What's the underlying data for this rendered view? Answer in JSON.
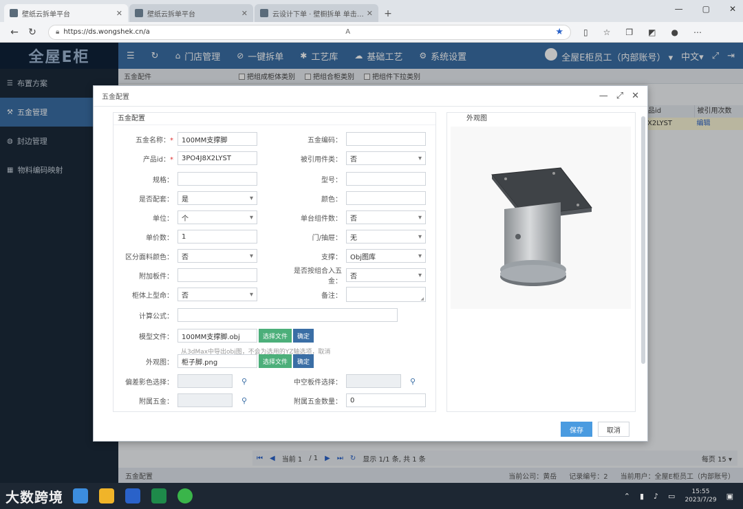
{
  "browser": {
    "tabs": [
      {
        "title": "壁纸云拆单平台",
        "active": true
      },
      {
        "title": "壁纸云拆单平台",
        "active": false
      },
      {
        "title": "云设计下单 · 壁橱拆单 单击…",
        "active": false
      }
    ],
    "url": "https://ds.wongshek.cn/a"
  },
  "app": {
    "logo": "全屋E柜",
    "nav": [
      {
        "icon": "home-icon",
        "label": "门店管理"
      },
      {
        "icon": "split-icon",
        "label": "一键拆单"
      },
      {
        "icon": "tool-icon",
        "label": "工艺库"
      },
      {
        "icon": "process-icon",
        "label": "基础工艺"
      },
      {
        "icon": "gear-icon",
        "label": "系统设置"
      }
    ],
    "user": "全屋E柜员工（内部账号）",
    "lang": "中文"
  },
  "sidebar": {
    "items": [
      {
        "label": "布置方案",
        "active": false
      },
      {
        "label": "五金管理",
        "active": true
      },
      {
        "label": "封边管理",
        "active": false
      },
      {
        "label": "物料编码映射",
        "active": false
      }
    ]
  },
  "main": {
    "crumb": "五金配件",
    "subtabs": [
      "把组成柜体类别",
      "把组合柜类别",
      "把组件下拉类别"
    ],
    "table_headers": [
      "品id",
      "被引用次数"
    ],
    "table_row": {
      "id": "X2LYST",
      "action": "编辑"
    },
    "pager": {
      "page_label": "当前 1",
      "total": "/ 1",
      "summary": "显示 1/1 条, 共 1 条",
      "page_size_label": "每页",
      "page_size": "15"
    },
    "status": {
      "left": "五金配置",
      "company": "当前公司：黄岳",
      "records": "记录编号：2",
      "user": "当前用户：全屋E柜员工（内部账号）"
    }
  },
  "dialog": {
    "title": "五金配置",
    "section_left": "五金配置",
    "section_right": "外观图",
    "fields": {
      "hardware_name_label": "五金名称：",
      "hardware_name": "100MM支撑脚",
      "hardware_code_label": "五金编码：",
      "hardware_code": "",
      "product_id_label": "产品id：",
      "product_id": "3PO4J8X2LYST",
      "order_type_label": "被引用件类：",
      "order_type": "否",
      "spec_label": "规格：",
      "spec": "",
      "model_label": "型号：",
      "model": "",
      "is_package_label": "是否配套：",
      "is_package": "是",
      "color_label": "颜色：",
      "color": "",
      "unit_label": "单位：",
      "unit": "个",
      "unit_qty_label": "单台组件数：",
      "unit_qty": "否",
      "single_qty_label": "单价数：",
      "single_qty": "1",
      "door_direction_label": "门/抽屉：",
      "door_direction": "无",
      "distinguish_label": "区分面料颜色：",
      "distinguish": "否",
      "support_label": "支撑：",
      "support": "Obj图库",
      "attach_label": "附加板件：",
      "attach": "",
      "as_hardware_label": "是否按组合入五金：",
      "as_hardware": "否",
      "upload_label": "柜体上型命：",
      "upload": "否",
      "remark_label": "备注：",
      "remark": "",
      "formula_label": "计算公式：",
      "formula": "",
      "model_file_label": "模型文件：",
      "model_file": "100MM支撑脚.obj",
      "model_hint": "从3dMax中导出obj图，不会为选用的YZ轴选项，取消",
      "appearance_label": "外观图：",
      "appearance_file": "柜子脚.png",
      "edge_linkage_label": "偏差影色选择：",
      "edge_linkage": "",
      "mid_board_label": "中空板件选择：",
      "mid_board": "",
      "extra_hw_label": "附属五金：",
      "extra_hw": "",
      "extra_hw_qty_label": "附属五金数量：",
      "extra_hw_qty": "0",
      "choose_file_btn": "选择文件",
      "confirm_btn": "确定"
    },
    "save_btn": "保存",
    "cancel_btn": "取消"
  },
  "taskbar": {
    "watermark": "大数跨境",
    "time": "15:55",
    "date": "2023/7/29"
  }
}
